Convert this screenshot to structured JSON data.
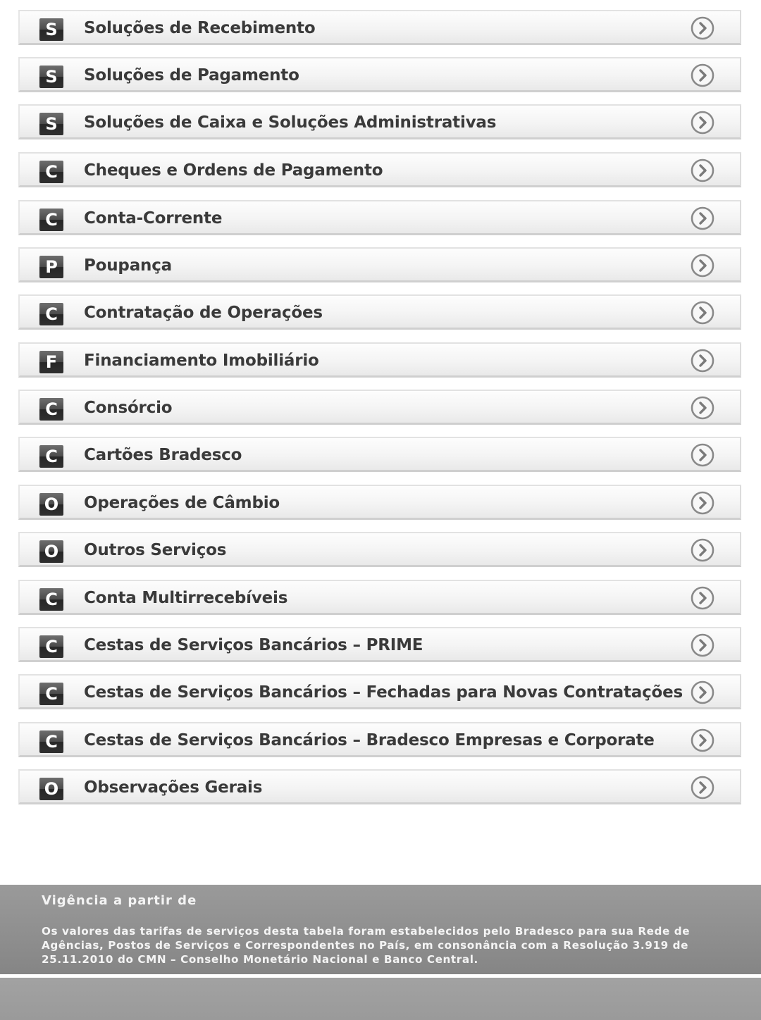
{
  "menu": {
    "items": [
      {
        "badge": "S",
        "label": "Soluções de Recebimento"
      },
      {
        "badge": "S",
        "label": "Soluções de Pagamento"
      },
      {
        "badge": "S",
        "label": "Soluções de Caixa e Soluções Administrativas"
      },
      {
        "badge": "C",
        "label": "Cheques e Ordens de Pagamento"
      },
      {
        "badge": "C",
        "label": "Conta-Corrente"
      },
      {
        "badge": "P",
        "label": "Poupança"
      },
      {
        "badge": "C",
        "label": "Contratação de Operações"
      },
      {
        "badge": "F",
        "label": "Financiamento Imobiliário"
      },
      {
        "badge": "C",
        "label": "Consórcio"
      },
      {
        "badge": "C",
        "label": "Cartões Bradesco"
      },
      {
        "badge": "O",
        "label": "Operações de Câmbio"
      },
      {
        "badge": "O",
        "label": "Outros Serviços"
      },
      {
        "badge": "C",
        "label": "Conta Multirrecebíveis"
      },
      {
        "badge": "C",
        "label": "Cestas de Serviços Bancários – PRIME"
      },
      {
        "badge": "C",
        "label": "Cestas de Serviços Bancários – Fechadas para Novas Contratações"
      },
      {
        "badge": "C",
        "label": "Cestas de Serviços Bancários – Bradesco Empresas e Corporate"
      },
      {
        "badge": "O",
        "label": "Observações Gerais"
      }
    ],
    "arrow_icon": "chevron-right-circle-icon"
  },
  "footer": {
    "title": "Vigência a partir de",
    "text": "Os valores das tarifas de serviços desta tabela foram estabelecidos pelo Bradesco para sua Rede de Agências, Postos de Serviços e Correspondentes no País, em consonância com a Resolução 3.919 de 25.11.2010 do CMN – Conselho Monetário Nacional e Banco Central."
  },
  "colors": {
    "badge": "#3a3a3a",
    "label": "#3a3a3a",
    "footer_band": "#939393",
    "footer_text": "#f4f4f4"
  }
}
